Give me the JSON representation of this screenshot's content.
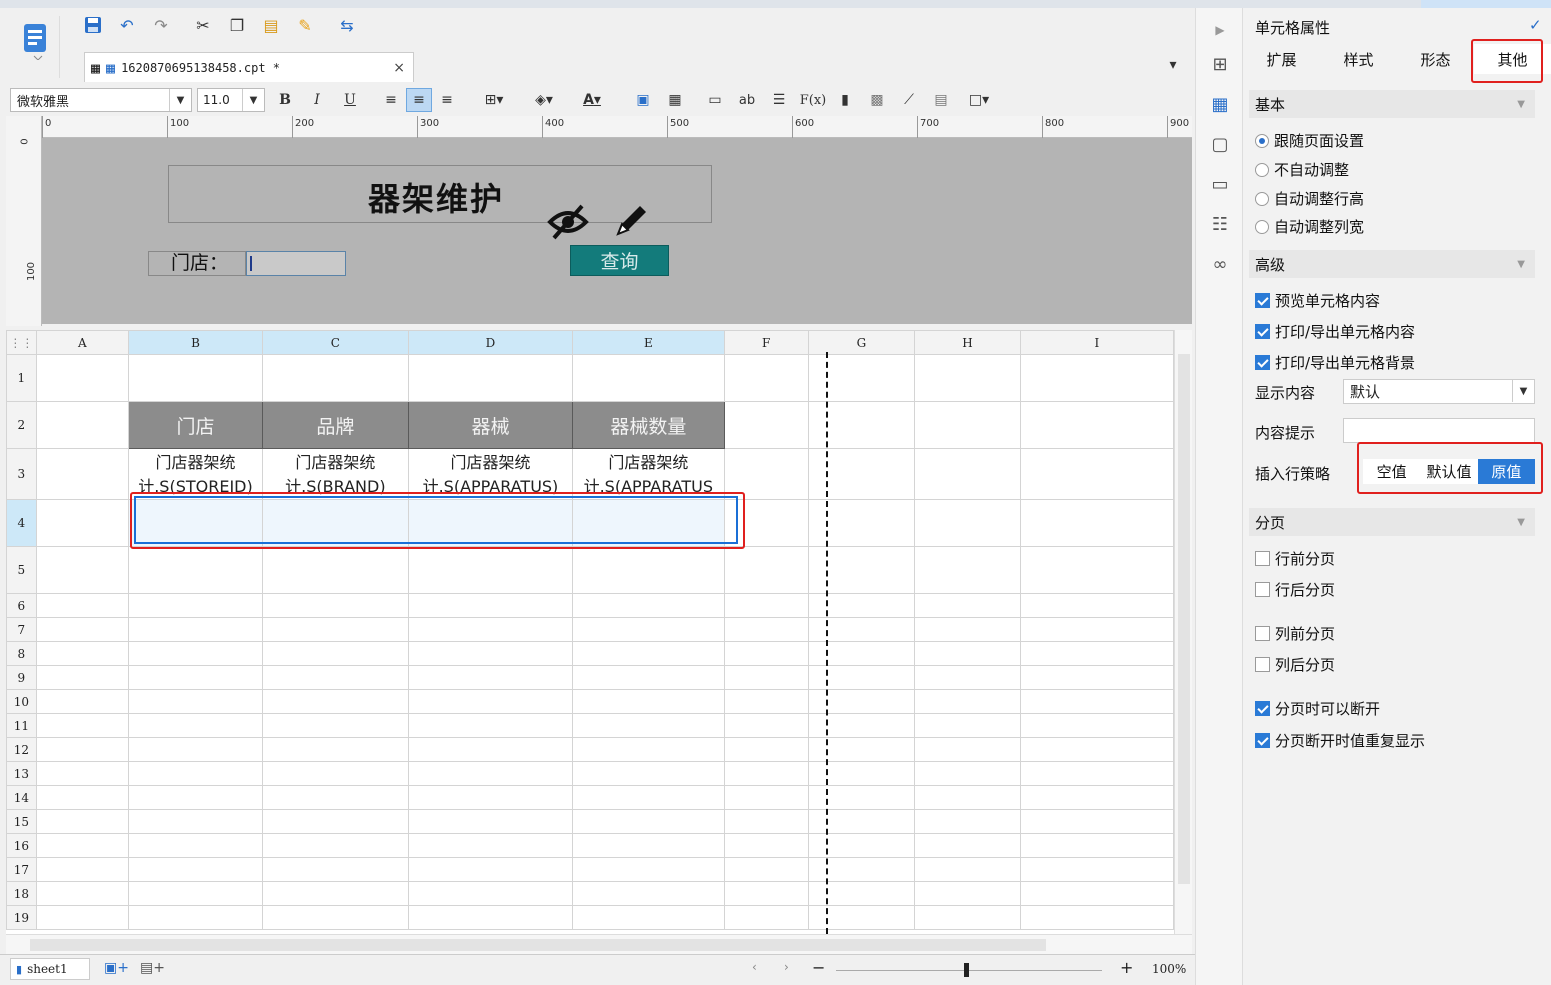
{
  "file_tab": {
    "name": "1620870695138458.cpt *",
    "close": "×"
  },
  "format_bar": {
    "font_family": "微软雅黑",
    "font_size": "11.0",
    "bold": "B",
    "italic": "I",
    "underline": "U",
    "text_color_glyph": "A"
  },
  "ruler": {
    "h_labels": [
      "0",
      "100",
      "200",
      "300",
      "400",
      "500",
      "600",
      "700",
      "800",
      "900"
    ],
    "v_labels": [
      "0",
      "100"
    ]
  },
  "form": {
    "title": "器架维护",
    "store_label": "门店：",
    "query_button": "查询"
  },
  "grid": {
    "columns": [
      "A",
      "B",
      "C",
      "D",
      "E",
      "F",
      "G",
      "H",
      "I"
    ],
    "selected_columns": [
      "B",
      "C",
      "D",
      "E"
    ],
    "rows": [
      "1",
      "2",
      "3",
      "4",
      "5",
      "6",
      "7",
      "8",
      "9",
      "10",
      "11",
      "12",
      "13",
      "14",
      "15",
      "16",
      "17",
      "18",
      "19"
    ],
    "header_cells": [
      "门店",
      "品牌",
      "器械",
      "器械数量"
    ],
    "field_cells": [
      "门店器架统计.S(STOREID)",
      "门店器架统计.S(BRAND)",
      "门店器架统计.S(APPARATUS)",
      "门店器架统计.S(APPARATUS"
    ]
  },
  "status": {
    "sheet_name": "sheet1",
    "zoom": "100%",
    "zoom_minus": "−",
    "zoom_plus": "+"
  },
  "properties": {
    "title": "单元格属性",
    "tabs": [
      "扩展",
      "样式",
      "形态",
      "其他"
    ],
    "active_tab": "其他",
    "sections": {
      "basic": "基本",
      "advanced": "高级",
      "paging": "分页"
    },
    "basic_options": [
      {
        "label": "跟随页面设置",
        "checked": true
      },
      {
        "label": "不自动调整",
        "checked": false
      },
      {
        "label": "自动调整行高",
        "checked": false
      },
      {
        "label": "自动调整列宽",
        "checked": false
      }
    ],
    "advanced_checks": [
      {
        "label": "预览单元格内容",
        "checked": true
      },
      {
        "label": "打印/导出单元格内容",
        "checked": true
      },
      {
        "label": "打印/导出单元格背景",
        "checked": true
      }
    ],
    "display_label": "显示内容",
    "display_value": "默认",
    "hint_label": "内容提示",
    "hint_value": "",
    "insert_label": "插入行策略",
    "insert_options": [
      "空值",
      "默认值",
      "原值"
    ],
    "insert_active": "原值",
    "paging_checks": [
      {
        "label": "行前分页",
        "checked": false
      },
      {
        "label": "行后分页",
        "checked": false
      },
      {
        "label": "列前分页",
        "checked": false
      },
      {
        "label": "列后分页",
        "checked": false
      },
      {
        "label": "分页时可以断开",
        "checked": true
      },
      {
        "label": "分页断开时值重复显示",
        "checked": true
      }
    ]
  },
  "colors": {
    "accent": "#2a7ad6",
    "highlight": "#e0201e",
    "query_button": "#137b7b",
    "header_fill": "#8c8c8c"
  }
}
